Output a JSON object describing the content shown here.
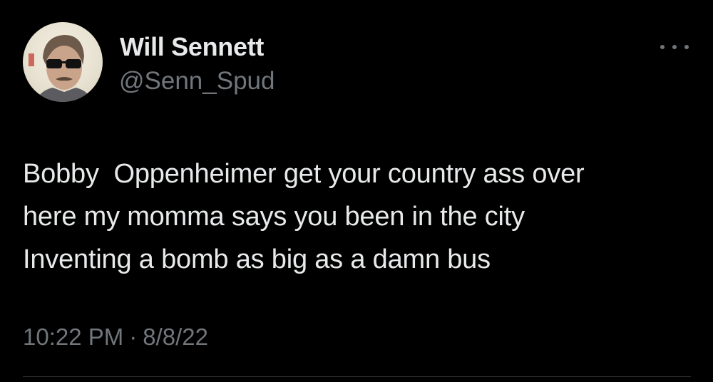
{
  "author": {
    "display_name": "Will Sennett",
    "handle": "@Senn_Spud",
    "avatar_icon": "profile-photo"
  },
  "tweet": {
    "text": "Bobby  Oppenheimer get your country ass over\nhere my momma says you been in the city\nInventing a bomb as big as a damn bus",
    "time": "10:22 PM",
    "separator": "·",
    "date": "8/8/22"
  },
  "menu": {
    "icon": "more-options-icon"
  },
  "colors": {
    "background": "#000000",
    "primary_text": "#e7e9ea",
    "secondary_text": "#71767b",
    "divider": "#2f3336"
  }
}
